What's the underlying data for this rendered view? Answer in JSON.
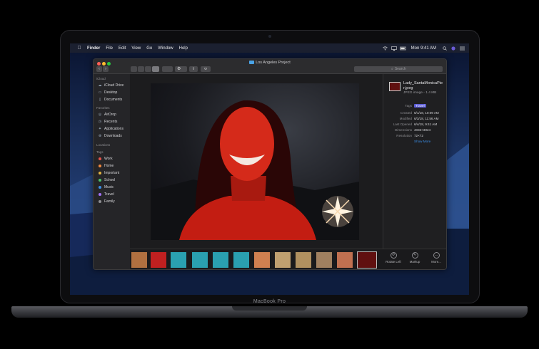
{
  "device": {
    "label": "MacBook Pro"
  },
  "menubar": {
    "apple_icon": "apple-logo-icon",
    "items": [
      "Finder",
      "File",
      "Edit",
      "View",
      "Go",
      "Window",
      "Help"
    ],
    "clock": "Mon 9:41 AM"
  },
  "window": {
    "title": "Los Angeles Project",
    "search_placeholder": "Search"
  },
  "sidebar": {
    "icloud_heading": "iCloud",
    "icloud_items": [
      "iCloud Drive",
      "Desktop",
      "Documents"
    ],
    "favorites_heading": "Favorites",
    "favorites_items": [
      "AirDrop",
      "Recents",
      "Applications",
      "Downloads"
    ],
    "locations_heading": "Locations",
    "tags_heading": "Tags",
    "tags": [
      {
        "label": "Work",
        "color": "#e5534b"
      },
      {
        "label": "Home",
        "color": "#f0883e"
      },
      {
        "label": "Important",
        "color": "#e3b341"
      },
      {
        "label": "School",
        "color": "#4ac26b"
      },
      {
        "label": "Music",
        "color": "#3a8de6"
      },
      {
        "label": "Travel",
        "color": "#a371f7"
      },
      {
        "label": "Family",
        "color": "#8e8e92"
      }
    ]
  },
  "info": {
    "filename": "Lady_SantaMonicaPie r.jpeg",
    "filetype": "JPEG image - 1.4 MB",
    "rows": [
      {
        "key": "Tags",
        "value": "Travel"
      },
      {
        "key": "Created",
        "value": "6/1/18, 10:09 AM"
      },
      {
        "key": "Modified",
        "value": "6/3/18, 11:56 AM"
      },
      {
        "key": "Last Opened",
        "value": "6/4/18, 9:41 AM"
      },
      {
        "key": "Dimensions",
        "value": "4032×3024"
      },
      {
        "key": "Resolution",
        "value": "72×72"
      }
    ],
    "show_more": "Show More"
  },
  "actions": [
    "Rotate Left",
    "Markup",
    "More..."
  ],
  "filmstrip_colors": [
    "#b07040",
    "#c02020",
    "#2aa0b0",
    "#2aa0b0",
    "#2aa0b0",
    "#2aa0b0",
    "#d08050",
    "#c0a070",
    "#b09060",
    "#a08060",
    "#c07050",
    "#601010"
  ]
}
